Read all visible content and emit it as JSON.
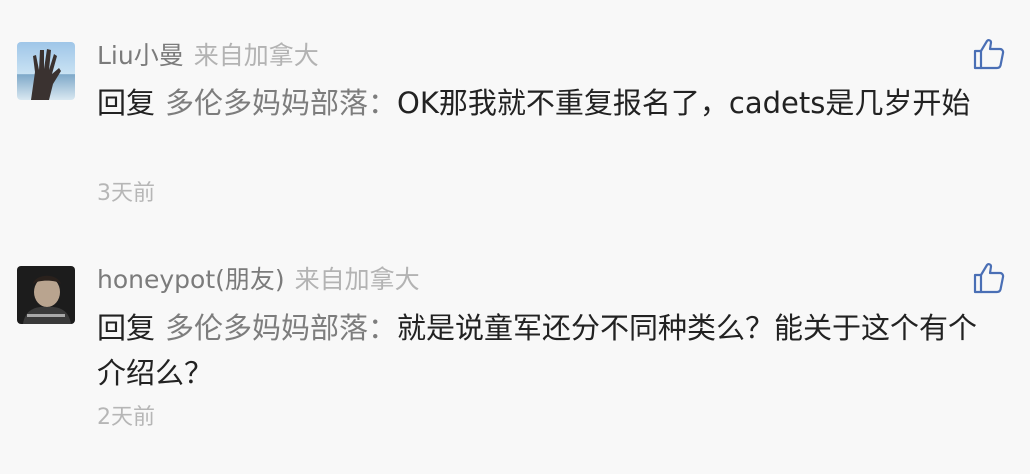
{
  "comments": [
    {
      "username": "Liu小曼",
      "location": "来自加拿大",
      "reply_prefix": "回复",
      "reply_to": "多伦多妈妈部落：",
      "text": "OK那我就不重复报名了，cadets是几岁开始",
      "time": "3天前",
      "avatar_icon": "hand-photo-avatar",
      "like_icon": "thumbs-up-icon"
    },
    {
      "username": "honeypot(朋友)",
      "location": "来自加拿大",
      "reply_prefix": "回复",
      "reply_to": "多伦多妈妈部落：",
      "text": "就是说童军还分不同种类么？能关于这个有个介绍么？",
      "time": "2天前",
      "avatar_icon": "movie-still-avatar",
      "like_icon": "thumbs-up-icon"
    }
  ],
  "colors": {
    "background": "#f8f8f8",
    "username": "#7b7b7b",
    "location": "#b3b3b3",
    "body_text": "#222222",
    "reply_target": "#7d7d7d",
    "time": "#b6b6b6",
    "like_icon": "#4a6fb5"
  }
}
